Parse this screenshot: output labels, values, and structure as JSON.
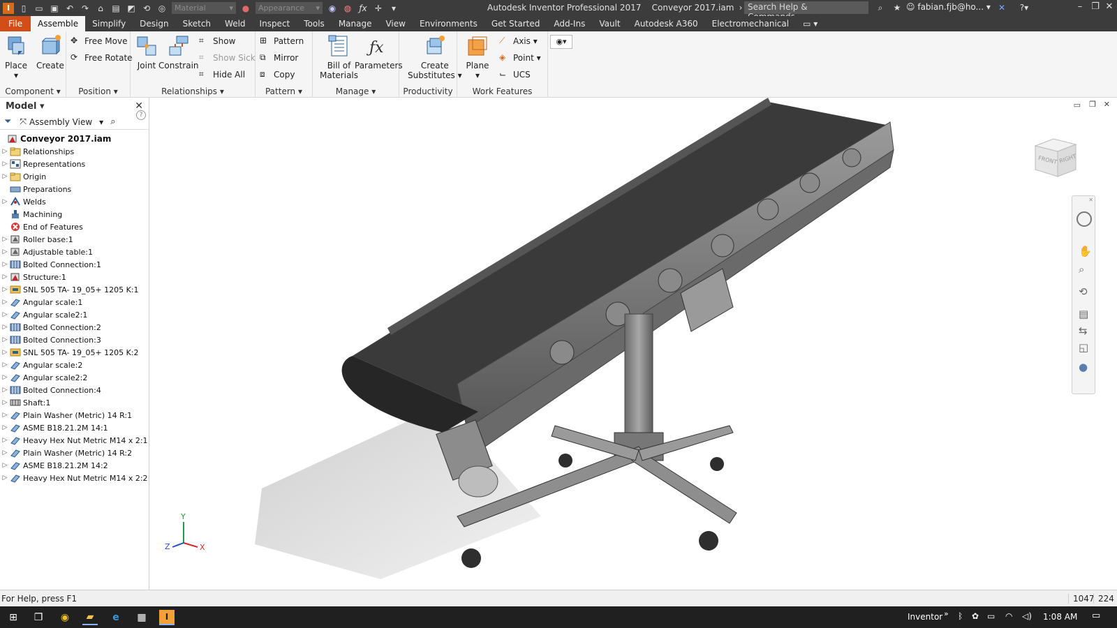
{
  "titlebar": {
    "app_title": "Autodesk Inventor Professional 2017",
    "document": "Conveyor 2017.iam",
    "material_placeholder": "Material",
    "appearance_placeholder": "Appearance",
    "search_placeholder": "Search Help & Commands...",
    "user": "fabian.fjb@ho..."
  },
  "tabs": [
    "File",
    "Assemble",
    "Simplify",
    "Design",
    "Sketch",
    "Weld",
    "Inspect",
    "Tools",
    "Manage",
    "View",
    "Environments",
    "Get Started",
    "Add-Ins",
    "Vault",
    "Autodesk A360",
    "Electromechanical"
  ],
  "active_tab": "Assemble",
  "ribbon": {
    "component": {
      "title": "Component",
      "place": "Place",
      "create": "Create"
    },
    "position": {
      "title": "Position",
      "free_move": "Free Move",
      "free_rotate": "Free Rotate"
    },
    "relationships": {
      "title": "Relationships",
      "joint": "Joint",
      "constrain": "Constrain",
      "show": "Show",
      "show_sick": "Show Sick",
      "hide_all": "Hide All"
    },
    "pattern": {
      "title": "Pattern",
      "pattern": "Pattern",
      "mirror": "Mirror",
      "copy": "Copy"
    },
    "manage": {
      "title": "Manage",
      "bom_line1": "Bill of",
      "bom_line2": "Materials",
      "parameters": "Parameters"
    },
    "productivity": {
      "title": "Productivity",
      "line1": "Create",
      "line2": "Substitutes"
    },
    "work_features": {
      "title": "Work Features",
      "plane": "Plane",
      "axis": "Axis",
      "point": "Point",
      "ucs": "UCS"
    }
  },
  "browser": {
    "title": "Model",
    "view": "Assembly View",
    "root": "Conveyor 2017.iam",
    "items": [
      {
        "label": "Relationships",
        "icon": "folder",
        "exp": true
      },
      {
        "label": "Representations",
        "icon": "representations",
        "exp": true
      },
      {
        "label": "Origin",
        "icon": "folder",
        "exp": true
      },
      {
        "label": "Preparations",
        "icon": "preparations",
        "exp": false
      },
      {
        "label": "Welds",
        "icon": "welds",
        "exp": true
      },
      {
        "label": "Machining",
        "icon": "machining",
        "exp": false
      },
      {
        "label": "End of Features",
        "icon": "end-of-features",
        "exp": false
      },
      {
        "label": "Roller base:1",
        "icon": "subassembly",
        "exp": true
      },
      {
        "label": "Adjustable table:1",
        "icon": "subassembly",
        "exp": true
      },
      {
        "label": "Bolted Connection:1",
        "icon": "bolted",
        "exp": true
      },
      {
        "label": "Structure:1",
        "icon": "structure",
        "exp": true
      },
      {
        "label": "SNL 505 TA- 19_05+ 1205 K:1",
        "icon": "bearing",
        "exp": true
      },
      {
        "label": "Angular scale:1",
        "icon": "part",
        "exp": true
      },
      {
        "label": "Angular scale2:1",
        "icon": "part",
        "exp": true
      },
      {
        "label": "Bolted Connection:2",
        "icon": "bolted",
        "exp": true
      },
      {
        "label": "Bolted Connection:3",
        "icon": "bolted",
        "exp": true
      },
      {
        "label": "SNL 505 TA- 19_05+ 1205 K:2",
        "icon": "bearing",
        "exp": true
      },
      {
        "label": "Angular scale:2",
        "icon": "part",
        "exp": true
      },
      {
        "label": "Angular scale2:2",
        "icon": "part",
        "exp": true
      },
      {
        "label": "Bolted Connection:4",
        "icon": "bolted",
        "exp": true
      },
      {
        "label": "Shaft:1",
        "icon": "shaft",
        "exp": true
      },
      {
        "label": "Plain Washer (Metric) 14 R:1",
        "icon": "part",
        "exp": true
      },
      {
        "label": "ASME B18.21.2M 14:1",
        "icon": "part",
        "exp": true
      },
      {
        "label": "Heavy Hex Nut Metric M14 x 2:1",
        "icon": "part",
        "exp": true
      },
      {
        "label": "Plain Washer (Metric) 14 R:2",
        "icon": "part",
        "exp": true
      },
      {
        "label": "ASME B18.21.2M 14:2",
        "icon": "part",
        "exp": true
      },
      {
        "label": "Heavy Hex Nut Metric M14 x 2:2",
        "icon": "part",
        "exp": true
      }
    ]
  },
  "viewcube": {
    "front": "FRONT",
    "right": "RIGHT"
  },
  "triad": {
    "x": "X",
    "y": "Y",
    "z": "Z"
  },
  "status": {
    "help": "For Help, press F1",
    "count1": "1047",
    "count2": "224"
  },
  "taskbar": {
    "app": "Inventor",
    "time": "1:08 AM"
  },
  "colors": {
    "accent": "#d24d17",
    "chrome": "#3c3c3c",
    "ribbon": "#f5f5f5",
    "taskbar": "#202020"
  }
}
